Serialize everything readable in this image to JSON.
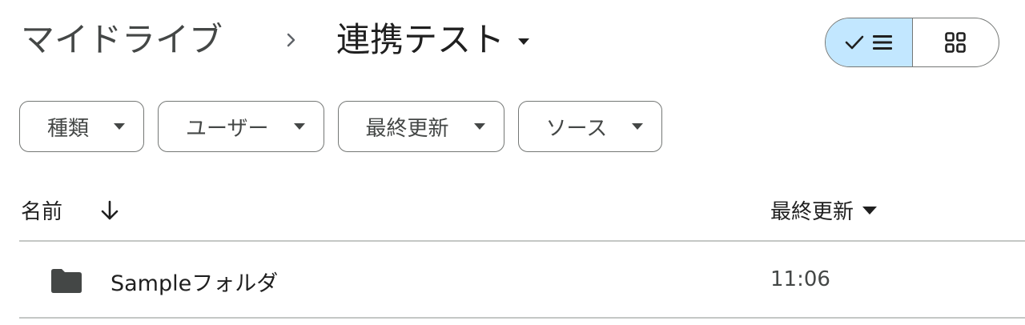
{
  "breadcrumb": {
    "root": "マイドライブ",
    "separator_icon": "chevron-right-icon",
    "current": "連携テスト"
  },
  "view_toggle": {
    "list_view": {
      "icon": "check-list-icon",
      "selected": true
    },
    "grid_view": {
      "icon": "grid-icon",
      "selected": false
    }
  },
  "filters": [
    {
      "label": "種類"
    },
    {
      "label": "ユーザー"
    },
    {
      "label": "最終更新"
    },
    {
      "label": "ソース"
    }
  ],
  "table": {
    "columns": {
      "name": "名前",
      "name_sort_icon": "arrow-down-icon",
      "modified": "最終更新"
    },
    "rows": [
      {
        "type_icon": "folder-icon",
        "name": "Sampleフォルダ",
        "modified": "11:06"
      }
    ]
  },
  "colors": {
    "accent": "#c2e7ff",
    "outline": "#747775",
    "divider": "#c4c7c5",
    "text_primary": "#1f1f1f",
    "text_secondary": "#444746"
  }
}
